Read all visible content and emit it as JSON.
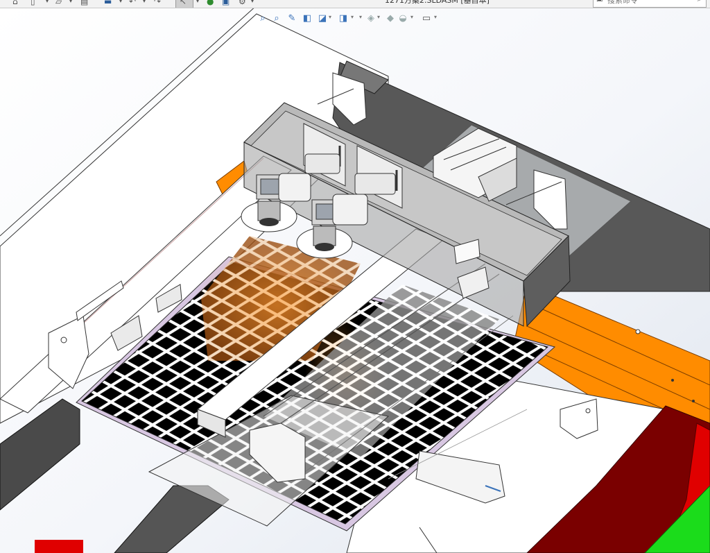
{
  "window": {
    "title": "1271方案2.SLDASM [基目本]"
  },
  "toolbar": {
    "left_icons": [
      "home-icon",
      "new-document-icon",
      "chevron-down-icon",
      "open-icon",
      "chevron-down-icon",
      "save-icon",
      "print-icon",
      "chevron-down-icon",
      "undo-icon",
      "chevron-down-icon",
      "redo-icon",
      "select-cursor-icon",
      "chevron-down-icon",
      "rebuild-icon",
      "file-properties-icon",
      "options-gear-icon",
      "chevron-down-icon"
    ]
  },
  "search": {
    "placeholder": "搜索命令"
  },
  "heads_up_toolbar": {
    "icons": [
      "zoom-to-fit-icon",
      "zoom-to-area-icon",
      "previous-view-icon",
      "section-view-icon",
      "dynamic-annotation-icon",
      "view-orientation-icon",
      "display-style-icon",
      "hide-show-items-icon",
      "edit-appearance-icon",
      "apply-scene-icon",
      "view-settings-icon"
    ]
  },
  "colors": {
    "accent_orange": "#ff8c00",
    "dark_red": "#7a0000",
    "red": "#e00000",
    "green": "#1bdc1b",
    "grid_black": "#000000",
    "grey_frame": "#8f8f8f",
    "highlight_blue": "#3b73b9"
  }
}
